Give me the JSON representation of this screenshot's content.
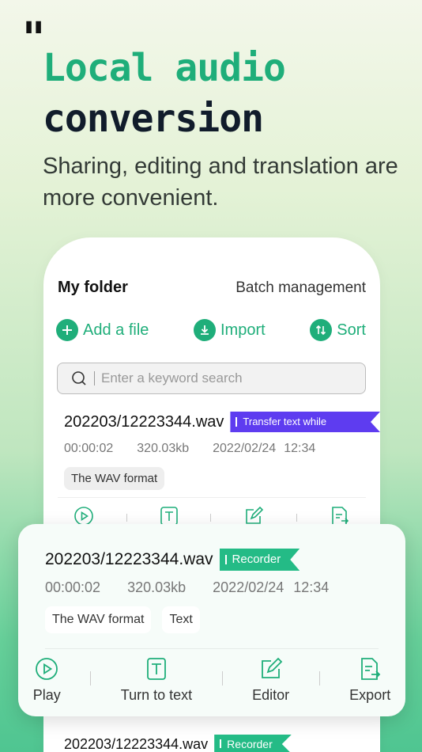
{
  "hero": {
    "quote": "\"",
    "headline_line1": "Local audio",
    "headline_line2": "conversion",
    "subtitle": "Sharing, editing and translation are more convenient."
  },
  "folder": {
    "title": "My folder",
    "batch_label": "Batch management",
    "actions": [
      {
        "label": "Add a file",
        "icon": "plus-icon"
      },
      {
        "label": "Import",
        "icon": "download-icon"
      },
      {
        "label": "Sort",
        "icon": "sort-icon"
      }
    ],
    "search_placeholder": "Enter a keyword search"
  },
  "recording1": {
    "filename": "202203/12223344.wav",
    "tag": "Transfer text while recording",
    "duration": "00:00:02",
    "size": "320.03kb",
    "date": "2022/02/24",
    "time": "12:34",
    "chips": [
      "The WAV format"
    ]
  },
  "recording2": {
    "filename": "202203/12223344.wav",
    "tag": "Recorder",
    "duration": "00:00:02",
    "size": "320.03kb",
    "date": "2022/02/24",
    "time": "12:34",
    "chips": [
      "The WAV format",
      "Text"
    ],
    "actions": [
      {
        "label": "Play",
        "icon": "play-icon"
      },
      {
        "label": "Turn to text",
        "icon": "text-icon"
      },
      {
        "label": "Editor",
        "icon": "edit-icon"
      },
      {
        "label": "Export",
        "icon": "export-icon"
      }
    ]
  },
  "recording3": {
    "filename": "202203/12223344.wav",
    "tag": "Recorder"
  },
  "colors": {
    "accent": "#1fae7a",
    "tag_purple": "#5e3cf0",
    "tag_green": "#24bb86"
  }
}
